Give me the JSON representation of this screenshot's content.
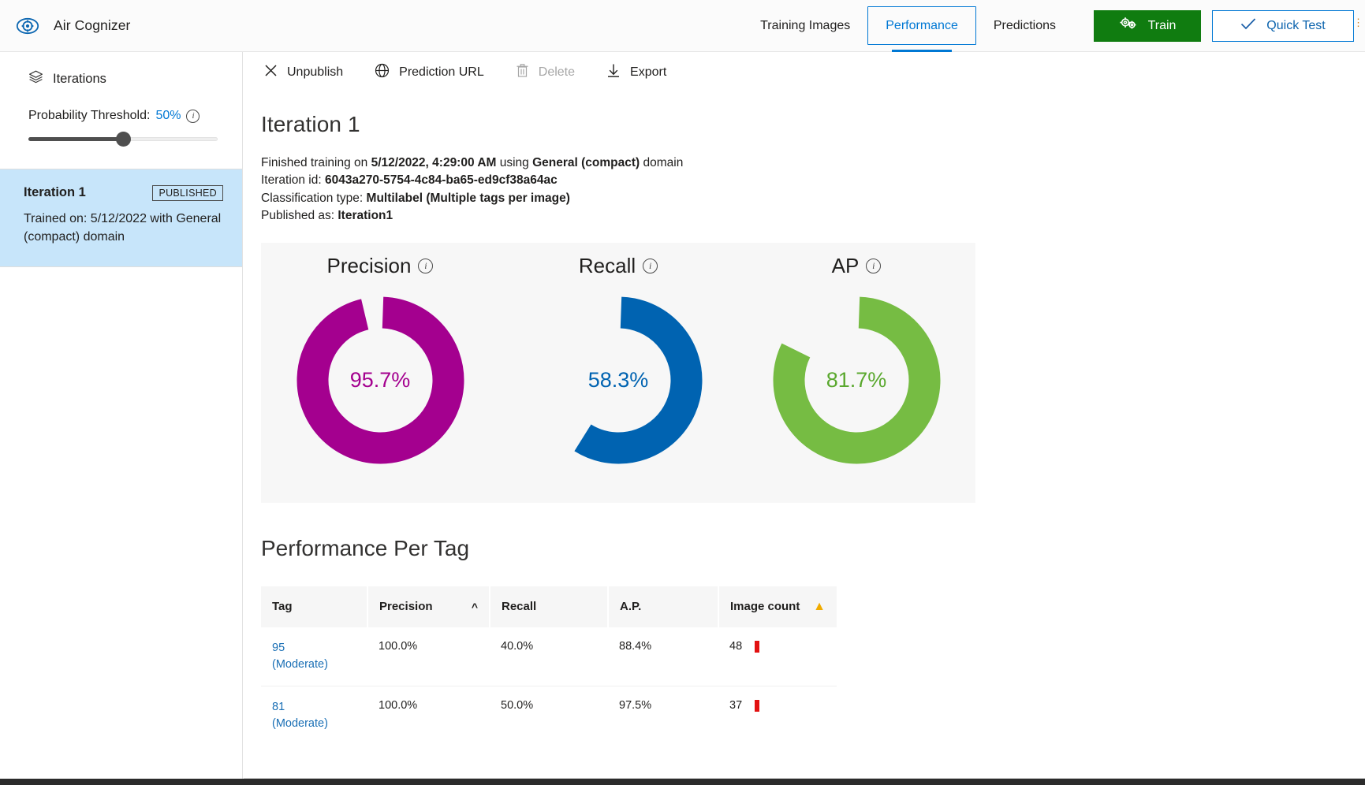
{
  "app": {
    "logo_icon": "eye-gear-icon",
    "name": "Air Cognizer"
  },
  "nav": {
    "tabs": [
      {
        "label": "Training Images",
        "active": false
      },
      {
        "label": "Performance",
        "active": true
      },
      {
        "label": "Predictions",
        "active": false
      }
    ],
    "train_button": {
      "label": "Train",
      "icon": "gears-icon",
      "color": "#107c10"
    },
    "quick_test_button": {
      "label": "Quick Test",
      "icon": "checkmark-icon",
      "color": "#0078d4"
    }
  },
  "sidebar": {
    "header": {
      "label": "Iterations",
      "icon": "layers-icon"
    },
    "threshold": {
      "label": "Probability Threshold:",
      "value": "50%",
      "percent": 50,
      "info_icon": "info-icon"
    },
    "iteration_card": {
      "title": "Iteration 1",
      "badge": "PUBLISHED",
      "subtitle": "Trained on: 5/12/2022 with General (compact) domain"
    }
  },
  "command_bar": {
    "items": [
      {
        "label": "Unpublish",
        "icon": "close-icon",
        "disabled": false
      },
      {
        "label": "Prediction URL",
        "icon": "globe-icon",
        "disabled": false
      },
      {
        "label": "Delete",
        "icon": "trash-icon",
        "disabled": true
      },
      {
        "label": "Export",
        "icon": "download-icon",
        "disabled": false
      }
    ]
  },
  "iteration": {
    "title": "Iteration 1",
    "finished_prefix": "Finished training on ",
    "finished_date": "5/12/2022, 4:29:00 AM",
    "finished_middle": " using ",
    "finished_domain": "General (compact)",
    "finished_suffix": " domain",
    "id_label": "Iteration id: ",
    "id_value": "6043a270-5754-4c84-ba65-ed9cf38a64ac",
    "classification_label": "Classification type: ",
    "classification_value": "Multilabel (Multiple tags per image)",
    "published_label": "Published as: ",
    "published_value": "Iteration1"
  },
  "chart_data": {
    "type": "pie",
    "title": "Iteration 1 overall performance",
    "legend": "none",
    "series": [
      {
        "name": "Precision",
        "value": 95.7,
        "display": "95.7%",
        "color": "#a4008f",
        "info_icon": "info-icon"
      },
      {
        "name": "Recall",
        "value": 58.3,
        "display": "58.3%",
        "color": "#0063b1",
        "info_icon": "info-icon"
      },
      {
        "name": "AP",
        "value": 81.7,
        "display": "81.7%",
        "color": "#76bc43",
        "info_icon": "info-icon"
      }
    ],
    "units": "percent",
    "ylim": [
      0,
      100
    ]
  },
  "per_tag": {
    "title": "Performance Per Tag",
    "columns": [
      {
        "label": "Tag",
        "sort": null,
        "warning": false
      },
      {
        "label": "Precision",
        "sort": "asc",
        "warning": false
      },
      {
        "label": "Recall",
        "sort": null,
        "warning": false
      },
      {
        "label": "A.P.",
        "sort": null,
        "warning": false
      },
      {
        "label": "Image count",
        "sort": null,
        "warning": true
      }
    ],
    "sort_icon": "chevron-up-icon",
    "warning_icon": "warning-triangle-icon",
    "rows": [
      {
        "tag": "95\n(Moderate)",
        "precision": "100.0%",
        "recall": "40.0%",
        "ap": "88.4%",
        "image_count": "48",
        "flag": "low-image-count"
      },
      {
        "tag": "81\n(Moderate)",
        "precision": "100.0%",
        "recall": "50.0%",
        "ap": "97.5%",
        "image_count": "37",
        "flag": "low-image-count"
      }
    ]
  }
}
